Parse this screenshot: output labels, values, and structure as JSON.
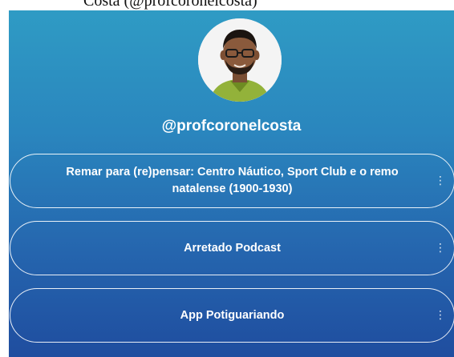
{
  "caption": "Costa (@profcoronelcosta)",
  "profile": {
    "handle": "@profcoronelcosta"
  },
  "links": [
    {
      "label": "Remar para (re)pensar: Centro Náutico, Sport Club e o remo natalense (1900-1930)",
      "menu_icon": "more-vertical-icon"
    },
    {
      "label": "Arretado Podcast",
      "menu_icon": "more-vertical-icon"
    },
    {
      "label": "App Potiguariando",
      "menu_icon": "more-vertical-icon"
    }
  ],
  "colors": {
    "gradient_top": "#2f9bc4",
    "gradient_bottom": "#1f4d9f",
    "text": "#ffffff"
  }
}
